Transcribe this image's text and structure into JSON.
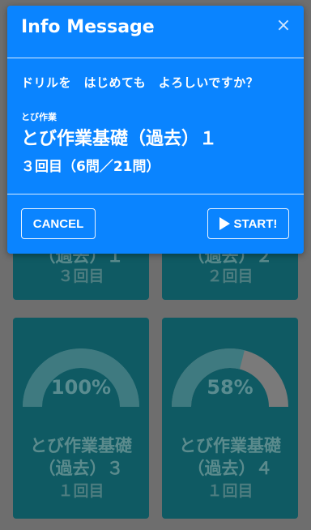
{
  "modal": {
    "title": "Info Message",
    "close_label": "×",
    "prompt": "ドリルを　はじめても　よろしいですか？",
    "subtitle": "とび作業",
    "drill_name": "とび作業基礎（過去）１",
    "attempt": "３回目（6問／21問）",
    "cancel_label": "CANCEL",
    "start_label": "START!"
  },
  "cards": {
    "top_left": {
      "title": "（過去）１",
      "count": "３回目"
    },
    "top_right": {
      "title": "（過去）２",
      "count": "２回目"
    },
    "bottom_left": {
      "percent": "100%",
      "percent_value": 1.0,
      "title1": "とび作業基礎",
      "title2": "（過去）３",
      "count": "１回目"
    },
    "bottom_right": {
      "percent": "58%",
      "percent_value": 0.58,
      "title1": "とび作業基礎",
      "title2": "（過去）４",
      "count": "１回目"
    }
  },
  "colors": {
    "modal_bg": "#0a84ff",
    "card_bg": "#0f5a63"
  }
}
